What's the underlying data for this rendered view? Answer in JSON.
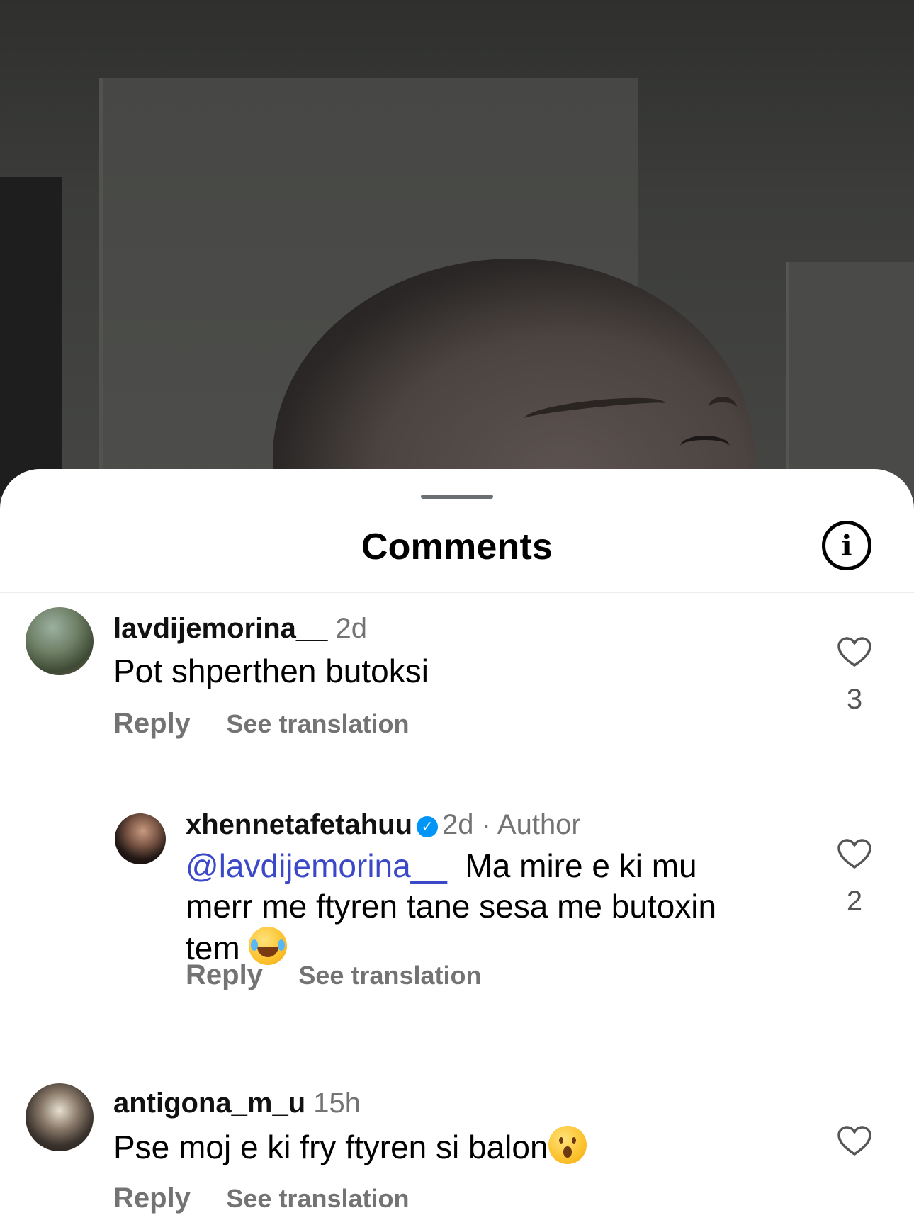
{
  "sheet": {
    "title": "Comments"
  },
  "comments": [
    {
      "username": "lavdijemorina__",
      "time": "2d",
      "text": "Pot shperthen butoksi",
      "reply_label": "Reply",
      "translate_label": "See translation",
      "likes": "3"
    },
    {
      "username": "xhennetafetahuu",
      "verified": true,
      "time": "2d",
      "author_tag": "· Author",
      "mention": "@lavdijemorina__",
      "text": "Ma mire e ki mu merr me ftyren tane sesa me butoxin tem",
      "emoji": "face-with-tears-of-joy",
      "reply_label": "Reply",
      "translate_label": "See translation",
      "likes": "2"
    },
    {
      "username": "antigona_m_u",
      "time": "15h",
      "text": "Pse moj e ki fry ftyren si balon",
      "emoji": "face-with-open-mouth",
      "reply_label": "Reply",
      "translate_label": "See translation",
      "likes": ""
    }
  ],
  "colors": {
    "mention": "#3b48c8",
    "muted": "#737373",
    "verified": "#0095f6"
  }
}
